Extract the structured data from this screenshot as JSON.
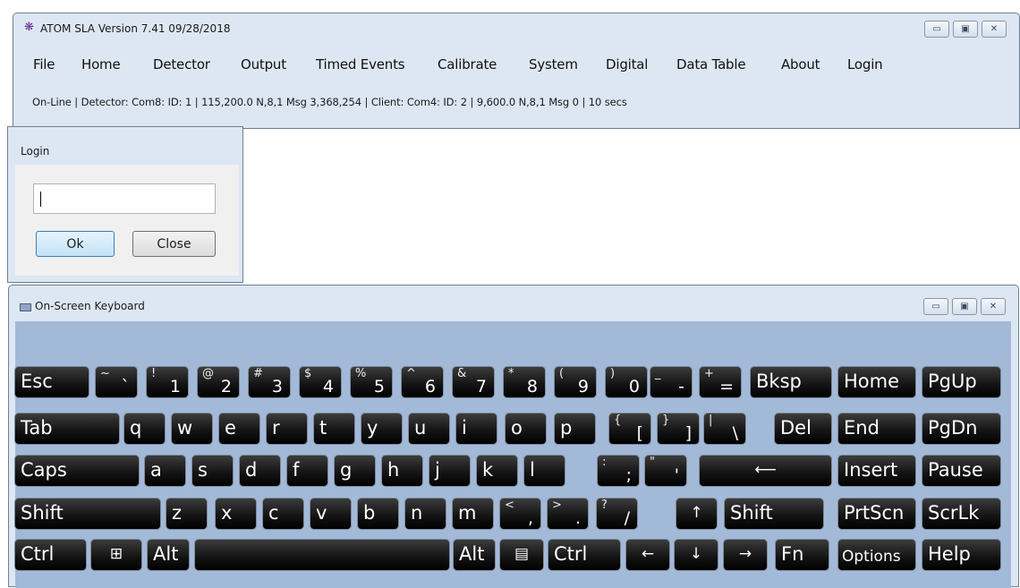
{
  "main_window": {
    "title": "ATOM  SLA  Version 7.41  09/28/2018",
    "icon": "atom-icon",
    "menu": [
      "File",
      "Home",
      "Detector",
      "Output",
      "Timed Events",
      "Calibrate",
      "System",
      "Digital",
      "Data Table",
      "About",
      "Login"
    ],
    "status": "On-Line |  Detector: Com8: ID: 1 | 115,200.0 N,8,1  Msg  3,368,254   | Client: Com4: ID: 2 | 9,600.0 N,8,1 Msg 0 | 10 secs"
  },
  "login_dialog": {
    "title": "Login",
    "input_value": "",
    "ok_label": "Ok",
    "close_label": "Close"
  },
  "keyboard": {
    "title": "On-Screen Keyboard",
    "icon": "keyboard-icon",
    "rows": [
      [
        {
          "label": "Esc"
        },
        {
          "sec": "~",
          "pri": "`"
        },
        {
          "sec": "!",
          "pri": "1"
        },
        {
          "sec": "@",
          "pri": "2"
        },
        {
          "sec": "#",
          "pri": "3"
        },
        {
          "sec": "$",
          "pri": "4"
        },
        {
          "sec": "%",
          "pri": "5"
        },
        {
          "sec": "^",
          "pri": "6"
        },
        {
          "sec": "&",
          "pri": "7"
        },
        {
          "sec": "*",
          "pri": "8"
        },
        {
          "sec": "(",
          "pri": "9"
        },
        {
          "sec": ")",
          "pri": "0"
        },
        {
          "sec": "_",
          "pri": "-"
        },
        {
          "sec": "+",
          "pri": "="
        },
        {
          "label": "Bksp"
        },
        {
          "label": "Home"
        },
        {
          "label": "PgUp"
        }
      ],
      [
        {
          "label": "Tab"
        },
        {
          "label": "q"
        },
        {
          "label": "w"
        },
        {
          "label": "e"
        },
        {
          "label": "r"
        },
        {
          "label": "t"
        },
        {
          "label": "y"
        },
        {
          "label": "u"
        },
        {
          "label": "i"
        },
        {
          "label": "o"
        },
        {
          "label": "p"
        },
        {
          "sec": "{",
          "pri": "["
        },
        {
          "sec": "}",
          "pri": "]"
        },
        {
          "sec": "|",
          "pri": "\\"
        },
        {
          "label": "Del"
        },
        {
          "label": "End"
        },
        {
          "label": "PgDn"
        }
      ],
      [
        {
          "label": "Caps"
        },
        {
          "label": "a"
        },
        {
          "label": "s"
        },
        {
          "label": "d"
        },
        {
          "label": "f"
        },
        {
          "label": "g"
        },
        {
          "label": "h"
        },
        {
          "label": "j"
        },
        {
          "label": "k"
        },
        {
          "label": "l"
        },
        {
          "sec": ":",
          "pri": ";"
        },
        {
          "sec": "\"",
          "pri": "'"
        },
        {
          "glyph": "⟵",
          "icon": "enter-icon"
        },
        {
          "label": "Insert"
        },
        {
          "label": "Pause"
        }
      ],
      [
        {
          "label": "Shift"
        },
        {
          "label": "z"
        },
        {
          "label": "x"
        },
        {
          "label": "c"
        },
        {
          "label": "v"
        },
        {
          "label": "b"
        },
        {
          "label": "n"
        },
        {
          "label": "m"
        },
        {
          "sec": "<",
          "pri": ","
        },
        {
          "sec": ">",
          "pri": "."
        },
        {
          "sec": "?",
          "pri": "/"
        },
        {
          "glyph": "↑",
          "icon": "up-arrow-icon"
        },
        {
          "label": "Shift"
        },
        {
          "label": "PrtScn"
        },
        {
          "label": "ScrLk"
        }
      ],
      [
        {
          "label": "Ctrl"
        },
        {
          "glyph": "⊞",
          "icon": "windows-logo-icon"
        },
        {
          "label": "Alt"
        },
        {
          "label": ""
        },
        {
          "label": "Alt"
        },
        {
          "glyph": "▤",
          "icon": "menu-key-icon"
        },
        {
          "label": "Ctrl"
        },
        {
          "glyph": "←",
          "icon": "left-arrow-icon"
        },
        {
          "glyph": "↓",
          "icon": "down-arrow-icon"
        },
        {
          "glyph": "→",
          "icon": "right-arrow-icon"
        },
        {
          "label": "Fn"
        },
        {
          "label": "Options",
          "small": true
        },
        {
          "label": "Help"
        }
      ]
    ]
  }
}
